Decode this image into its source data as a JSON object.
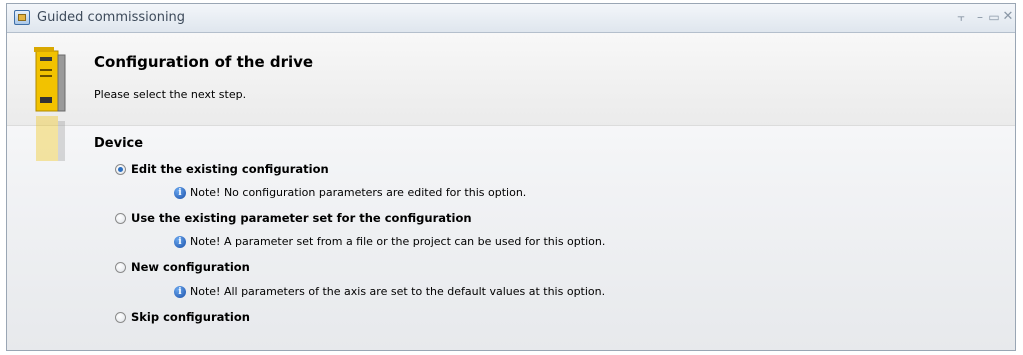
{
  "window": {
    "title": "Guided commissioning",
    "controls": {
      "pin_icon": "⫟",
      "minimize_icon": "–",
      "maximize_icon": "▭",
      "close_icon": "✕"
    }
  },
  "header": {
    "title": "Configuration of the drive",
    "subtitle": "Please select the next step."
  },
  "section": {
    "title": "Device"
  },
  "info_icon_glyph": "i",
  "options": [
    {
      "label": "Edit the existing configuration",
      "checked": true,
      "note": "Note! No configuration parameters are edited for this option."
    },
    {
      "label": "Use the existing parameter set for the configuration",
      "checked": false,
      "note": "Note! A parameter set from a file or the project can be used for this option."
    },
    {
      "label": "New configuration",
      "checked": false,
      "note": "Note! All parameters of the axis are set to the default values at this option."
    },
    {
      "label": "Skip configuration",
      "checked": false
    }
  ],
  "colors": {
    "accent_radio": "#2d6fc0",
    "drive_yellow": "#f2c200",
    "info_blue": "#1a4fa8"
  }
}
